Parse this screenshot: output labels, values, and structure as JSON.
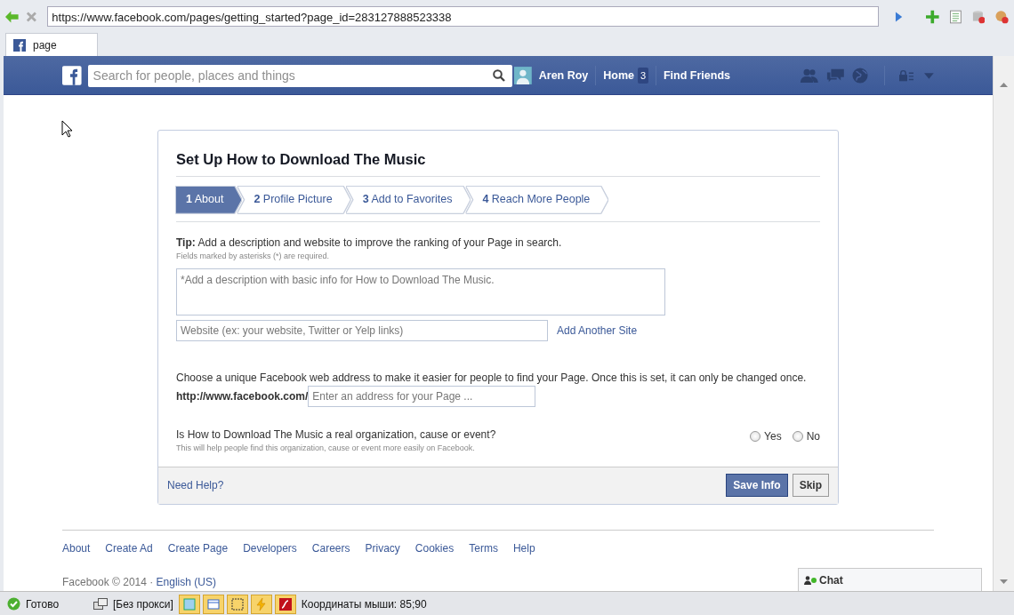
{
  "browser": {
    "address": "https://www.facebook.com/pages/getting_started?page_id=283127888523338",
    "tabs": [
      {
        "label": "page",
        "selected": true
      }
    ]
  },
  "header": {
    "search_placeholder": "Search for people, places and things",
    "user_name": "Aren Roy",
    "home_label": "Home",
    "home_count": "3",
    "find_friends": "Find Friends"
  },
  "setup": {
    "title": "Set Up How to Download The Music",
    "steps": [
      {
        "number": "1",
        "label": "About",
        "selected": true
      },
      {
        "number": "2",
        "label": "Profile Picture",
        "selected": false
      },
      {
        "number": "3",
        "label": "Add to Favorites",
        "selected": false
      },
      {
        "number": "4",
        "label": "Reach More People",
        "selected": false
      }
    ],
    "tip": "**Tip:** Add a description and website to improve the ranking of your Page in search.",
    "required_note": "Fields marked by asterisks (*) are required.",
    "description_placeholder": "*Add a description with basic info for How to Download The Music.",
    "website_placeholder": "Website (ex: your website, Twitter or Yelp links)",
    "add_site_link": "Add Another Site",
    "address_prompt": "Choose a unique Facebook web address to make it easier for people to find your Page. Once this is set, it can only be changed once.",
    "address_prefix": "http://www.facebook.com/",
    "address_placeholder": "Enter an address for your Page ...",
    "question": "Is How to Download The Music a real organization, cause or event?",
    "question_note": "This will help people find this organization, cause or event more easily on Facebook.",
    "options": [
      {
        "label": "Yes",
        "selected": false
      },
      {
        "label": "No",
        "selected": false
      }
    ],
    "need_help": "Need Help?",
    "buttons": [
      {
        "label": "Save Info",
        "kind": "primary"
      },
      {
        "label": "Skip",
        "kind": "secondary"
      }
    ]
  },
  "footer": {
    "links": [
      "About",
      "Create Ad",
      "Create Page",
      "Developers",
      "Careers",
      "Privacy",
      "Cookies",
      "Terms",
      "Help"
    ],
    "copyright": "Facebook © 2014 ·",
    "language": "English (US)"
  },
  "chat": {
    "label": "Chat"
  },
  "status_bar": {
    "status": "Готово",
    "proxy": "[Без прокси]",
    "coordinates": "Координаты мыши: 85;90"
  }
}
